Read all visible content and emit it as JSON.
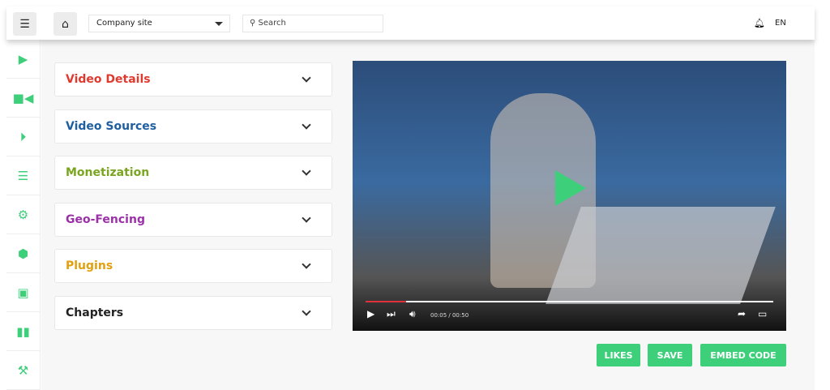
{
  "topbar": {
    "site_select": "Company site",
    "search_placeholder": "Search",
    "language": "EN"
  },
  "sidebar": {
    "items": [
      "youtube-icon",
      "video-camera-icon",
      "play-circle-icon",
      "list-icon",
      "gear-icon",
      "cube-icon",
      "image-icon",
      "bar-chart-icon",
      "gavel-icon"
    ]
  },
  "accordion": [
    {
      "label": "Video Details",
      "color": "#e03a2f"
    },
    {
      "label": "Video Sources",
      "color": "#1f5fa0"
    },
    {
      "label": "Monetization",
      "color": "#7aa51f"
    },
    {
      "label": "Geo-Fencing",
      "color": "#9b30a8"
    },
    {
      "label": "Plugins",
      "color": "#e0a010"
    },
    {
      "label": "Chapters",
      "color": "#222222"
    }
  ],
  "player": {
    "time": "00:05 / 00:50",
    "progress": 0.1
  },
  "buttons": {
    "likes": "LIKES",
    "save": "SAVE",
    "embed": "EMBED CODE"
  },
  "accent": "#3ecf7a"
}
